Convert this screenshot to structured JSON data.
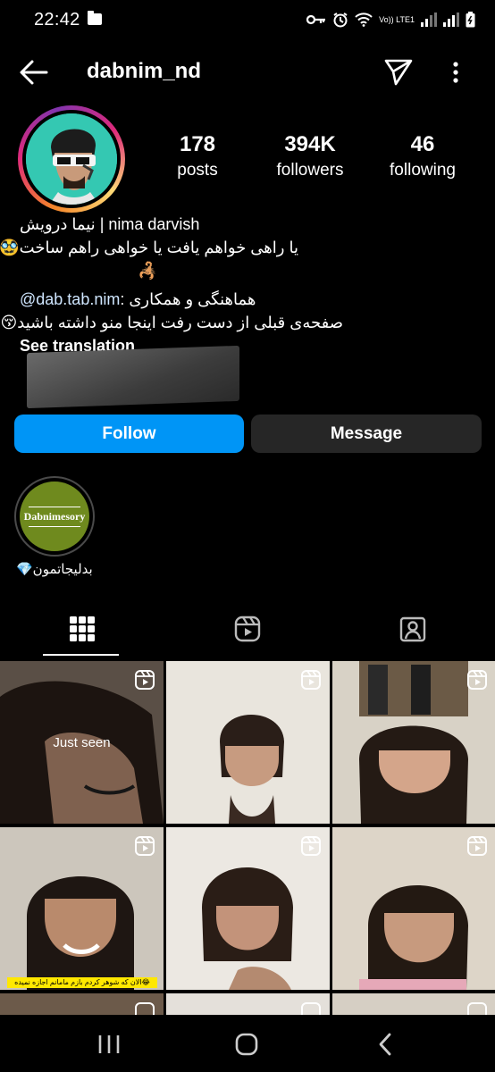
{
  "status_bar": {
    "time": "22:42",
    "network": "Vo)) LTE1"
  },
  "header": {
    "username": "dabnim_nd"
  },
  "stats": {
    "posts": {
      "value": "178",
      "label": "posts"
    },
    "followers": {
      "value": "394K",
      "label": "followers"
    },
    "following": {
      "value": "46",
      "label": "following"
    }
  },
  "bio": {
    "name": "نیما درویش | nima darvish",
    "line1": "یا راهی خواهم یافت یا خواهی راهم ساخت🥸",
    "line2": "🦂",
    "line3_prefix": "هماهنگی و همکاری : ",
    "line3_mention": "@dab.tab.nim",
    "line4": "صفحه‌ی قبلی از دست رفت اینجا منو داشته باشید😚",
    "see_translation": "See translation"
  },
  "buttons": {
    "follow": "Follow",
    "message": "Message"
  },
  "highlight": {
    "cover_text": "Dabnimesory",
    "label": "بدلیجاتمون💎"
  },
  "grid": {
    "just_seen": "Just seen",
    "caption": "الان که شوهر کردم بازم مامانم اجازه نمیده😂"
  },
  "colors": {
    "accent": "#0095f6",
    "button_secondary": "#262626",
    "background": "#000000"
  }
}
